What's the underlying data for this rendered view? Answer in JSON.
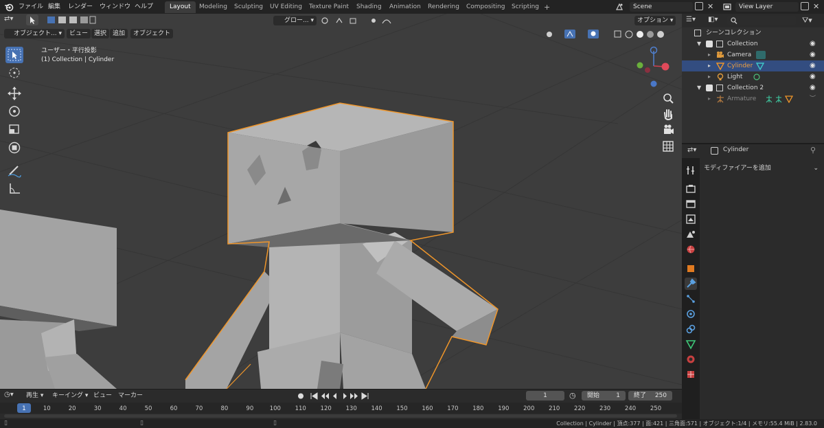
{
  "menubar": {
    "items": [
      "ファイル",
      "編集",
      "レンダー",
      "ウィンドウ",
      "ヘルプ"
    ],
    "workspaces": [
      "Layout",
      "Modeling",
      "Sculpting",
      "UV Editing",
      "Texture Paint",
      "Shading",
      "Animation",
      "Rendering",
      "Compositing",
      "Scripting"
    ],
    "active_workspace": "Layout",
    "add_tab": "+",
    "scene": "Scene",
    "view_layer": "View Layer"
  },
  "viewport_header": {
    "mode": "オブジェクト...",
    "menus": [
      "ビュー",
      "選択",
      "追加",
      "オブジェクト"
    ],
    "transform_orientation": "グロー...",
    "options": "オプション"
  },
  "viewport_overlay": {
    "projection": "ユーザー・平行投影",
    "context": "(1) Collection | Cylinder"
  },
  "outliner": {
    "title": "シーンコレクション",
    "rows": [
      {
        "name": "Collection",
        "type": "collection",
        "indent": 1
      },
      {
        "name": "Camera",
        "type": "camera",
        "indent": 2
      },
      {
        "name": "Cylinder",
        "type": "mesh",
        "indent": 2,
        "selected": true
      },
      {
        "name": "Light",
        "type": "light",
        "indent": 2
      },
      {
        "name": "Collection 2",
        "type": "collection",
        "indent": 1
      },
      {
        "name": "Armature",
        "type": "armature",
        "indent": 2,
        "dimmed": true
      }
    ]
  },
  "properties": {
    "object_name": "Cylinder",
    "add_modifier": "モディファイアーを追加"
  },
  "timeline": {
    "menus": [
      "再生",
      "キーイング",
      "ビュー",
      "マーカー"
    ],
    "current_frame": "1",
    "start_label": "開始",
    "start": "1",
    "end_label": "終了",
    "end": "250",
    "ticks": [
      "1",
      "10",
      "20",
      "30",
      "40",
      "50",
      "60",
      "70",
      "80",
      "90",
      "100",
      "110",
      "120",
      "130",
      "140",
      "150",
      "160",
      "170",
      "180",
      "190",
      "200",
      "210",
      "220",
      "230",
      "240",
      "250"
    ]
  },
  "statusbar": {
    "text": "Collection | Cylinder | 頂点:377 | 面:421 | 三角面:571 | オブジェクト:1/4 | メモリ:55.4 MiB | 2.83.0"
  },
  "colors": {
    "accent": "#4772b3",
    "selection_outline": "#f0962a",
    "viewport_bg": "#3d3d3d",
    "mesh": "#a6a6a6"
  }
}
